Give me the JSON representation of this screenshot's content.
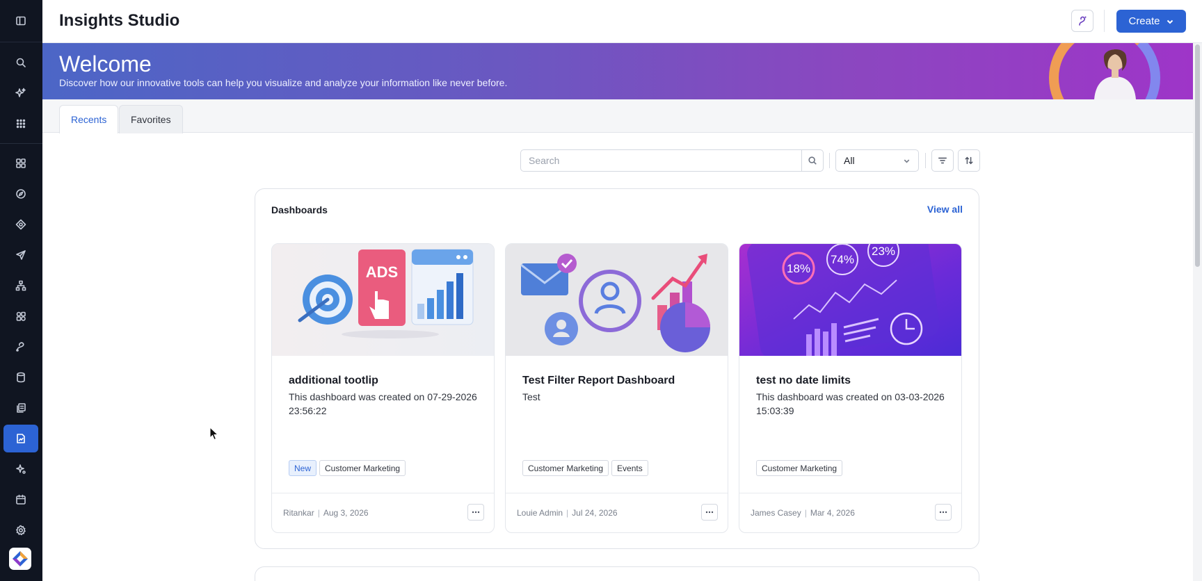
{
  "app": {
    "title": "Insights Studio"
  },
  "topbar": {
    "create_label": "Create",
    "assist_icon": "assist-icon"
  },
  "banner": {
    "title": "Welcome",
    "subtitle": "Discover how our innovative tools can help you visualize and analyze your information like never before."
  },
  "tabs": [
    {
      "label": "Recents",
      "active": true
    },
    {
      "label": "Favorites",
      "active": false
    }
  ],
  "toolbar": {
    "search_placeholder": "Search",
    "type_filter": "All"
  },
  "dashboards": {
    "title": "Dashboards",
    "view_all": "View all",
    "cards": [
      {
        "name": "additional tootlip",
        "description": "This dashboard was created on 07-29-2026 23:56:22",
        "tags": [
          "New",
          "Customer Marketing"
        ],
        "author": "Ritankar",
        "date": "Aug 3, 2026",
        "thumb_text": "ADS"
      },
      {
        "name": "Test Filter Report Dashboard",
        "description": "Test",
        "tags": [
          "Customer Marketing",
          "Events"
        ],
        "author": "Louie Admin",
        "date": "Jul 24, 2026"
      },
      {
        "name": "test no date limits",
        "description": "This dashboard was created on 03-03-2026 15:03:39",
        "tags": [
          "Customer Marketing"
        ],
        "author": "James Casey",
        "date": "Mar 4, 2026",
        "thumb_stats": [
          "18%",
          "74%",
          "23%"
        ]
      }
    ]
  },
  "colors": {
    "accent": "#2c63d4",
    "rail": "#101521"
  }
}
